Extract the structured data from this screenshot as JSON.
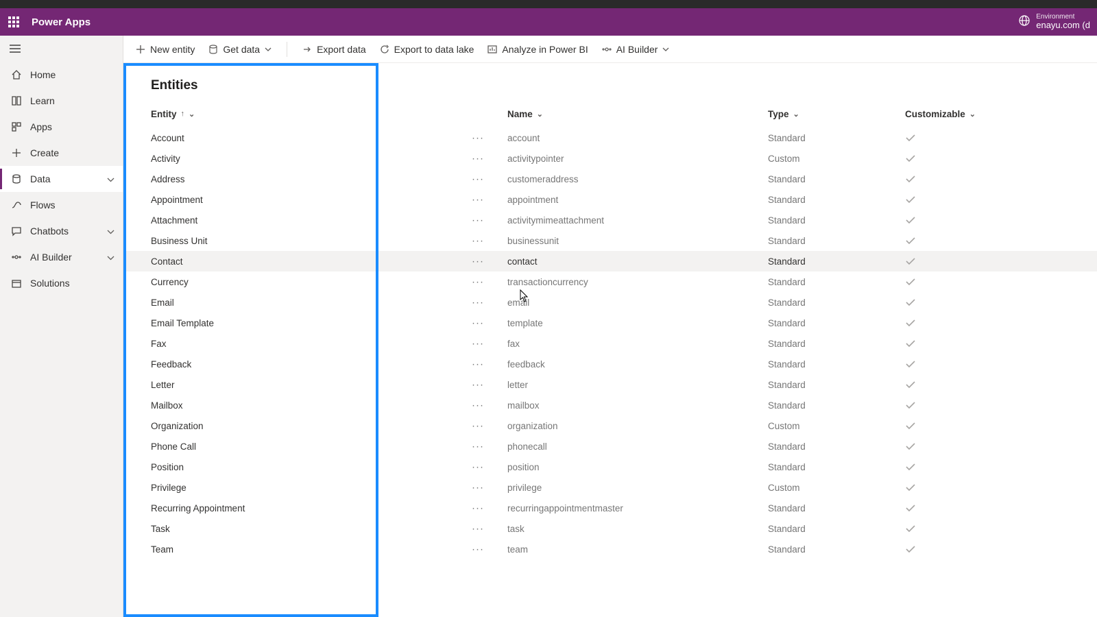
{
  "header": {
    "app_title": "Power Apps",
    "env_label": "Environment",
    "env_value": "enayu.com (d"
  },
  "sidebar": {
    "items": [
      {
        "label": "Home",
        "icon": "home",
        "chev": false,
        "active": false
      },
      {
        "label": "Learn",
        "icon": "book",
        "chev": false,
        "active": false
      },
      {
        "label": "Apps",
        "icon": "apps",
        "chev": false,
        "active": false
      },
      {
        "label": "Create",
        "icon": "plus",
        "chev": false,
        "active": false
      },
      {
        "label": "Data",
        "icon": "data",
        "chev": true,
        "active": true
      },
      {
        "label": "Flows",
        "icon": "flow",
        "chev": false,
        "active": false
      },
      {
        "label": "Chatbots",
        "icon": "chat",
        "chev": true,
        "active": false
      },
      {
        "label": "AI Builder",
        "icon": "ai",
        "chev": true,
        "active": false
      },
      {
        "label": "Solutions",
        "icon": "package",
        "chev": false,
        "active": false
      }
    ]
  },
  "cmdbar": {
    "new_entity": "New entity",
    "get_data": "Get data",
    "export_data": "Export data",
    "export_lake": "Export to data lake",
    "analyze": "Analyze in Power BI",
    "ai_builder": "AI Builder"
  },
  "page": {
    "title": "Entities"
  },
  "columns": {
    "entity": "Entity",
    "name": "Name",
    "type": "Type",
    "customizable": "Customizable"
  },
  "rows": [
    {
      "entity": "Account",
      "name": "account",
      "type": "Standard",
      "hover": false
    },
    {
      "entity": "Activity",
      "name": "activitypointer",
      "type": "Custom",
      "hover": false
    },
    {
      "entity": "Address",
      "name": "customeraddress",
      "type": "Standard",
      "hover": false
    },
    {
      "entity": "Appointment",
      "name": "appointment",
      "type": "Standard",
      "hover": false
    },
    {
      "entity": "Attachment",
      "name": "activitymimeattachment",
      "type": "Standard",
      "hover": false
    },
    {
      "entity": "Business Unit",
      "name": "businessunit",
      "type": "Standard",
      "hover": false
    },
    {
      "entity": "Contact",
      "name": "contact",
      "type": "Standard",
      "hover": true
    },
    {
      "entity": "Currency",
      "name": "transactioncurrency",
      "type": "Standard",
      "hover": false
    },
    {
      "entity": "Email",
      "name": "email",
      "type": "Standard",
      "hover": false
    },
    {
      "entity": "Email Template",
      "name": "template",
      "type": "Standard",
      "hover": false
    },
    {
      "entity": "Fax",
      "name": "fax",
      "type": "Standard",
      "hover": false
    },
    {
      "entity": "Feedback",
      "name": "feedback",
      "type": "Standard",
      "hover": false
    },
    {
      "entity": "Letter",
      "name": "letter",
      "type": "Standard",
      "hover": false
    },
    {
      "entity": "Mailbox",
      "name": "mailbox",
      "type": "Standard",
      "hover": false
    },
    {
      "entity": "Organization",
      "name": "organization",
      "type": "Custom",
      "hover": false
    },
    {
      "entity": "Phone Call",
      "name": "phonecall",
      "type": "Standard",
      "hover": false
    },
    {
      "entity": "Position",
      "name": "position",
      "type": "Standard",
      "hover": false
    },
    {
      "entity": "Privilege",
      "name": "privilege",
      "type": "Custom",
      "hover": false
    },
    {
      "entity": "Recurring Appointment",
      "name": "recurringappointmentmaster",
      "type": "Standard",
      "hover": false
    },
    {
      "entity": "Task",
      "name": "task",
      "type": "Standard",
      "hover": false
    },
    {
      "entity": "Team",
      "name": "team",
      "type": "Standard",
      "hover": false
    }
  ]
}
